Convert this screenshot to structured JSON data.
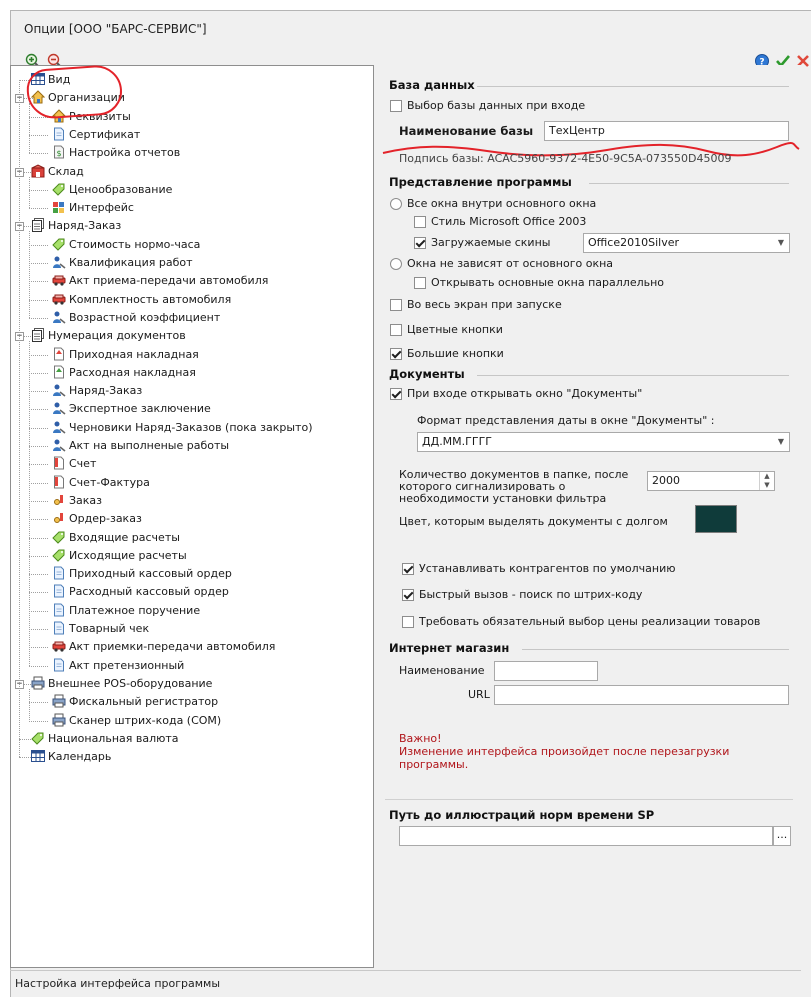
{
  "window": {
    "title": "Опции [ООО \"БАРС-СЕРВИС\"]"
  },
  "toolbar": {
    "zoom_in_icon": "zoom-in-icon",
    "zoom_out_icon": "zoom-out-icon",
    "help_icon": "help-icon",
    "ok_icon": "checkmark-icon",
    "cancel_icon": "close-icon"
  },
  "tree": {
    "items": [
      {
        "label": "Вид",
        "level": 0,
        "icon": "grid-icon"
      },
      {
        "label": "Организации",
        "level": 0,
        "icon": "house-icon",
        "expand": "−"
      },
      {
        "label": "Реквизиты",
        "level": 1,
        "icon": "house-icon"
      },
      {
        "label": "Сертификат",
        "level": 1,
        "icon": "document-icon"
      },
      {
        "label": "Настройка отчетов",
        "level": 1,
        "icon": "report-icon"
      },
      {
        "label": "Склад",
        "level": 0,
        "icon": "warehouse-icon",
        "expand": "−"
      },
      {
        "label": "Ценообразование",
        "level": 1,
        "icon": "tag-icon"
      },
      {
        "label": "Интерфейс",
        "level": 1,
        "icon": "interface-icon"
      },
      {
        "label": "Наряд-Заказ",
        "level": 0,
        "icon": "documents-icon",
        "expand": "−"
      },
      {
        "label": "Стоимость нормо-часа",
        "level": 1,
        "icon": "tag-icon"
      },
      {
        "label": "Квалификация работ",
        "level": 1,
        "icon": "worker-icon"
      },
      {
        "label": "Акт приема-передачи автомобиля",
        "level": 1,
        "icon": "car-icon"
      },
      {
        "label": "Комплектность автомобиля",
        "level": 1,
        "icon": "car-icon"
      },
      {
        "label": "Возрастной коэффициент",
        "level": 1,
        "icon": "worker-icon"
      },
      {
        "label": "Нумерация документов",
        "level": 0,
        "icon": "documents-icon",
        "expand": "−"
      },
      {
        "label": "Приходная накладная",
        "level": 1,
        "icon": "doc-red-icon"
      },
      {
        "label": "Расходная накладная",
        "level": 1,
        "icon": "doc-green-icon"
      },
      {
        "label": "Наряд-Заказ",
        "level": 1,
        "icon": "worker-icon"
      },
      {
        "label": "Экспертное заключение",
        "level": 1,
        "icon": "worker-icon"
      },
      {
        "label": "Черновики Наряд-Заказов (пока закрыто)",
        "level": 1,
        "icon": "worker-icon"
      },
      {
        "label": "Акт на выполненые работы",
        "level": 1,
        "icon": "worker-icon"
      },
      {
        "label": "Счет",
        "level": 1,
        "icon": "invoice-icon"
      },
      {
        "label": "Счет-Фактура",
        "level": 1,
        "icon": "invoice-icon"
      },
      {
        "label": "Заказ",
        "level": 1,
        "icon": "order-icon"
      },
      {
        "label": "Ордер-заказ",
        "level": 1,
        "icon": "order-icon"
      },
      {
        "label": "Входящие расчеты",
        "level": 1,
        "icon": "tag-icon"
      },
      {
        "label": "Исходящие расчеты",
        "level": 1,
        "icon": "tag-icon"
      },
      {
        "label": "Приходный кассовый ордер",
        "level": 1,
        "icon": "document-icon"
      },
      {
        "label": "Расходный кассовый ордер",
        "level": 1,
        "icon": "document-icon"
      },
      {
        "label": "Платежное поручение",
        "level": 1,
        "icon": "document-icon"
      },
      {
        "label": "Товарный чек",
        "level": 1,
        "icon": "document-icon"
      },
      {
        "label": "Акт приемки-передачи автомобиля",
        "level": 1,
        "icon": "car-icon"
      },
      {
        "label": "Акт претензионный",
        "level": 1,
        "icon": "document-icon"
      },
      {
        "label": "Внешнее POS-оборудование",
        "level": 0,
        "icon": "printer-icon",
        "expand": "−"
      },
      {
        "label": "Фискальный регистратор",
        "level": 1,
        "icon": "printer-icon"
      },
      {
        "label": "Сканер штрих-кода (COM)",
        "level": 1,
        "icon": "printer-icon"
      },
      {
        "label": "Национальная валюта",
        "level": 0,
        "icon": "tag-icon"
      },
      {
        "label": "Календарь",
        "level": 0,
        "icon": "grid-icon"
      }
    ]
  },
  "database": {
    "section_title": "База данных",
    "choose_on_login": "Выбор базы данных при входе",
    "choose_on_login_checked": false,
    "name_label": "Наименование базы",
    "name_value": "ТехЦентр",
    "signature": "Подпись базы: ACAC5960-9372-4E50-9C5A-073550D45009"
  },
  "presentation": {
    "section_title": "Представление программы",
    "inside_main": "Все окна внутри основного окна",
    "office_style": "Стиль Microsoft Office 2003",
    "office_style_checked": false,
    "loaded_skins": "Загружаемые скины",
    "loaded_skins_checked": true,
    "skin_value": "Office2010Silver",
    "independent": "Окна не зависят от основного окна",
    "parallel": "Открывать основные окна параллельно",
    "parallel_checked": false,
    "fullscreen": "Во весь экран при запуске",
    "fullscreen_checked": false,
    "colored_buttons": "Цветные кнопки",
    "colored_buttons_checked": false,
    "big_buttons": "Большие кнопки",
    "big_buttons_checked": true
  },
  "documents": {
    "section_title": "Документы",
    "open_on_login": "При входе открывать окно \"Документы\"",
    "open_on_login_checked": true,
    "date_format_label": "Формат представления даты в окне \"Документы\" :",
    "date_format_value": "ДД.ММ.ГГГГ",
    "count_label": "Количество документов в папке, после которого сигнализировать о необходимости установки фильтра",
    "count_value": "2000",
    "debt_color_label": "Цвет, которым выделять документы с долгом",
    "debt_color": "#0f3b3a",
    "set_contractors": "Устанавливать контрагентов по умолчанию",
    "set_contractors_checked": true,
    "quick_barcode": "Быстрый вызов - поиск по штрих-коду",
    "quick_barcode_checked": true,
    "require_price": "Требовать обязательный выбор цены реализации товаров",
    "require_price_checked": false
  },
  "shop": {
    "section_title": "Интернет магазин",
    "name_label": "Наименование",
    "name_value": "",
    "url_label": "URL",
    "url_value": ""
  },
  "warning": {
    "title": "Важно!",
    "text": "Изменение интерфейса произойдет после перезагрузки программы."
  },
  "sp": {
    "section_title": "Путь до иллюстраций норм времени SP",
    "value": "",
    "browse_label": "..."
  },
  "status": {
    "text": "Настройка интерфейса программы"
  },
  "colors": {
    "annotation": "#e3232a",
    "warning": "#b0151a",
    "accent_green": "#2e9a2e"
  }
}
